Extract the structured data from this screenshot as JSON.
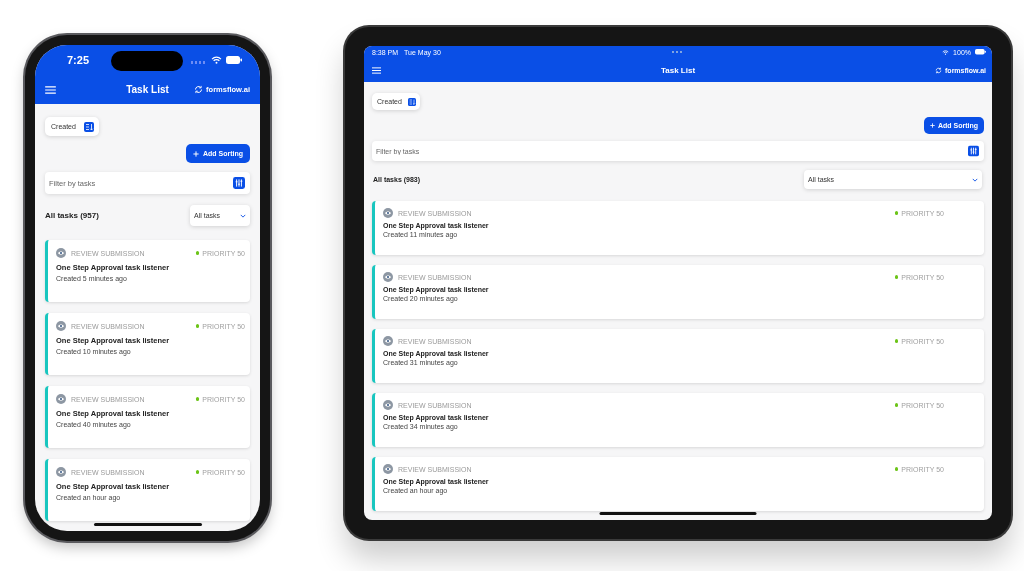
{
  "devices": [
    {
      "kind": "phone",
      "status_bar": {
        "time": "7:25"
      },
      "app": {
        "title": "Task List",
        "brand": "formsflow.ai",
        "sort_chip": "Created",
        "add_button": "Add Sorting",
        "filter": {
          "placeholder": "Filter by tasks"
        },
        "list_heading": "All tasks (957)",
        "list_select": "All tasks",
        "tasks": [
          {
            "type": "REVIEW SUBMISSION",
            "priority": "PRIORITY 50",
            "name": "One Step Approval task listener",
            "created": "Created 5 minutes ago"
          },
          {
            "type": "REVIEW SUBMISSION",
            "priority": "PRIORITY 50",
            "name": "One Step Approval task listener",
            "created": "Created 10 minutes ago"
          },
          {
            "type": "REVIEW SUBMISSION",
            "priority": "PRIORITY 50",
            "name": "One Step Approval task listener",
            "created": "Created 40 minutes ago"
          },
          {
            "type": "REVIEW SUBMISSION",
            "priority": "PRIORITY 50",
            "name": "One Step Approval task listener",
            "created": "Created an hour ago"
          }
        ]
      }
    },
    {
      "kind": "tablet",
      "status_bar": {
        "time": "8:38 PM",
        "date": "Tue May 30",
        "battery": "100%"
      },
      "app": {
        "title": "Task List",
        "brand": "formsflow.ai",
        "sort_chip": "Created",
        "add_button": "Add Sorting",
        "filter": {
          "placeholder": "Filter by tasks"
        },
        "list_heading": "All tasks (983)",
        "list_select": "All tasks",
        "tasks": [
          {
            "type": "REVIEW SUBMISSION",
            "priority": "PRIORITY 50",
            "name": "One Step Approval task listener",
            "created": "Created 11 minutes ago"
          },
          {
            "type": "REVIEW SUBMISSION",
            "priority": "PRIORITY 50",
            "name": "One Step Approval task listener",
            "created": "Created 20 minutes ago"
          },
          {
            "type": "REVIEW SUBMISSION",
            "priority": "PRIORITY 50",
            "name": "One Step Approval task listener",
            "created": "Created 31 minutes ago"
          },
          {
            "type": "REVIEW SUBMISSION",
            "priority": "PRIORITY 50",
            "name": "One Step Approval task listener",
            "created": "Created 34 minutes ago"
          },
          {
            "type": "REVIEW SUBMISSION",
            "priority": "PRIORITY 50",
            "name": "One Step Approval task listener",
            "created": "Created an hour ago"
          }
        ]
      }
    }
  ]
}
